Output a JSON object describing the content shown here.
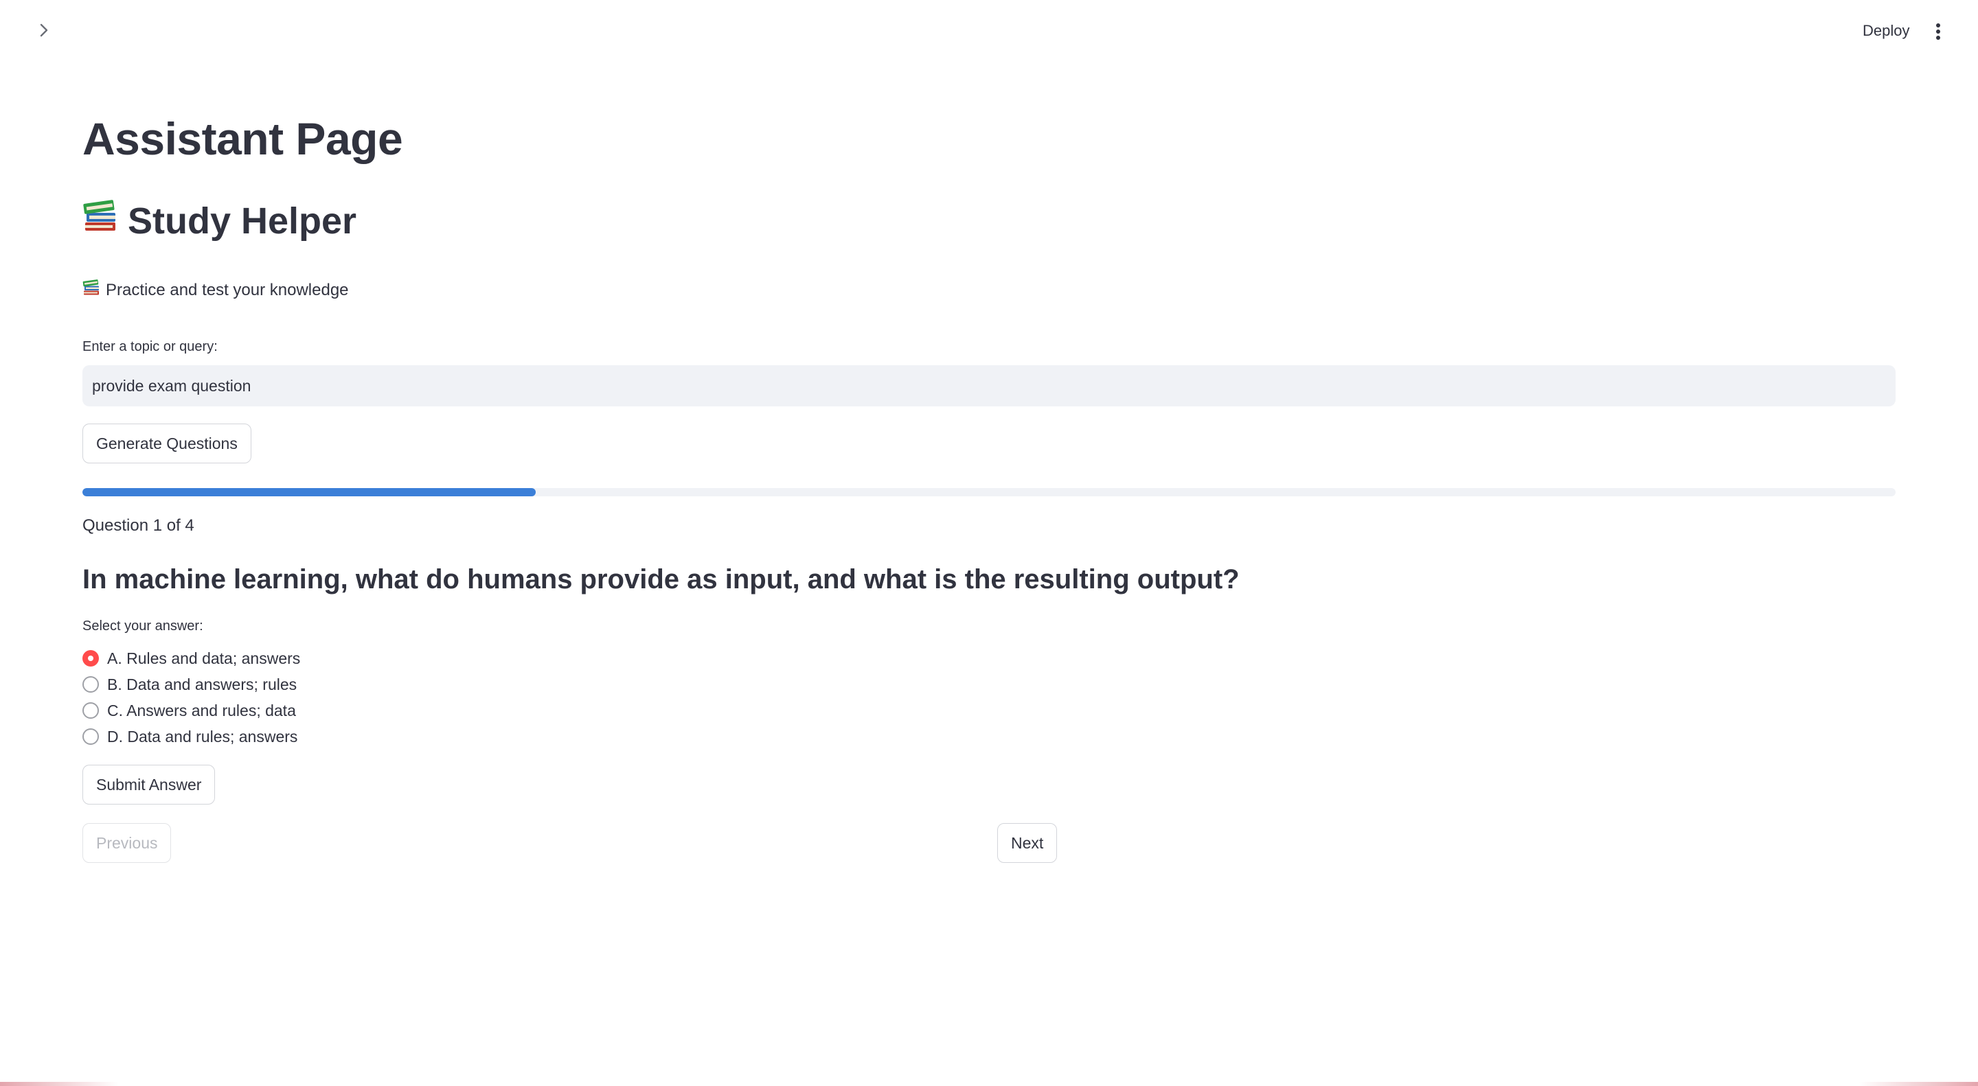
{
  "header": {
    "sidebar_toggle_icon": "chevron-right-icon",
    "deploy_label": "Deploy",
    "menu_icon": "kebab-menu-icon"
  },
  "page": {
    "title": "Assistant Page",
    "subtitle": "Study Helper",
    "subtitle_icon": "books-emoji",
    "tagline": "Practice and test your knowledge"
  },
  "query": {
    "label": "Enter a topic or query:",
    "value": "provide exam question",
    "generate_label": "Generate Questions"
  },
  "progress": {
    "fraction": 0.25,
    "fill_color": "#3b7fd8",
    "count_text": "Question 1 of 4"
  },
  "question": {
    "text": "In machine learning, what do humans provide as input, and what is the resulting output?",
    "answer_prompt": "Select your answer:",
    "options": [
      {
        "label": "A. Rules and data; answers",
        "selected": true
      },
      {
        "label": "B. Data and answers; rules",
        "selected": false
      },
      {
        "label": "C. Answers and rules; data",
        "selected": false
      },
      {
        "label": "D. Data and rules; answers",
        "selected": false
      }
    ],
    "selected_color": "#ff4b4b"
  },
  "actions": {
    "submit_label": "Submit Answer",
    "previous_label": "Previous",
    "next_label": "Next"
  }
}
